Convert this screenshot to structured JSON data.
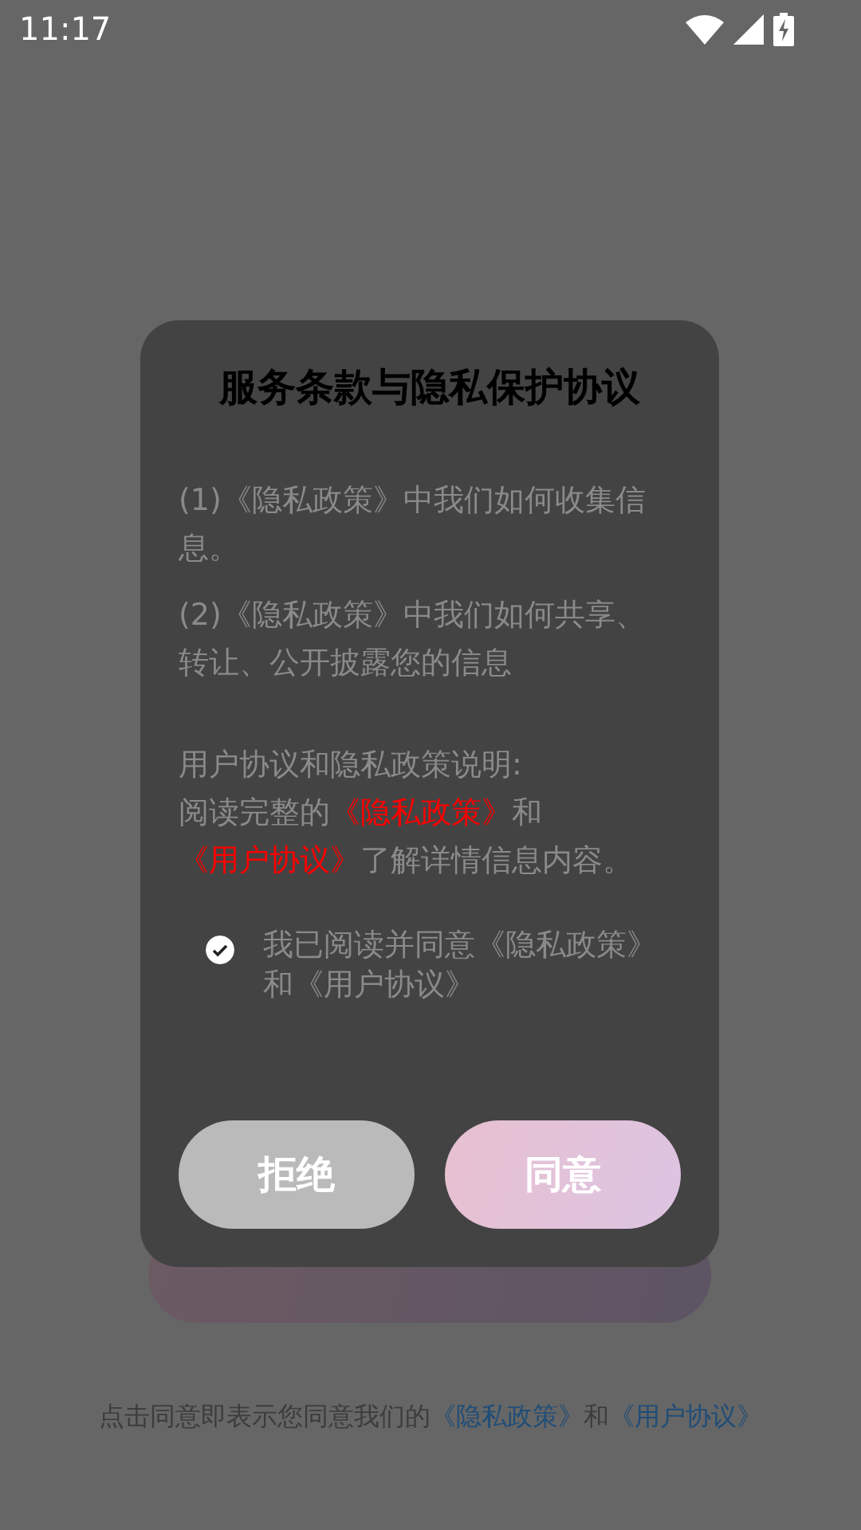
{
  "status_bar": {
    "time": "11:17"
  },
  "footer": {
    "parts": [
      {
        "kind": "plain",
        "text": "点击同意即表示您同意我们的"
      },
      {
        "kind": "link",
        "text": "《隐私政策》"
      },
      {
        "kind": "plain",
        "text": "和"
      },
      {
        "kind": "link",
        "text": "《用户协议》"
      }
    ]
  },
  "dialog": {
    "title": "服务条款与隐私保护协议",
    "paragraphs": [
      "(1)《隐私政策》中我们如何收集信息。",
      "(2)《隐私政策》中我们如何共享、转让、公开披露您的信息"
    ],
    "notice_heading": "用户协议和隐私政策说明:",
    "notice": [
      {
        "kind": "plain",
        "text": "阅读完整的"
      },
      {
        "kind": "link",
        "text": "《隐私政策》"
      },
      {
        "kind": "plain",
        "text": "和"
      },
      {
        "kind": "link",
        "text": "《用户协议》"
      },
      {
        "kind": "plain",
        "text": "了解详情信息内容。"
      }
    ],
    "agreement": {
      "label": "我已阅读并同意《隐私政策》和《用户协议》",
      "checked": true
    },
    "buttons": [
      {
        "kind": "secondary",
        "label": "拒绝"
      },
      {
        "kind": "primary",
        "label": "同意"
      }
    ]
  }
}
